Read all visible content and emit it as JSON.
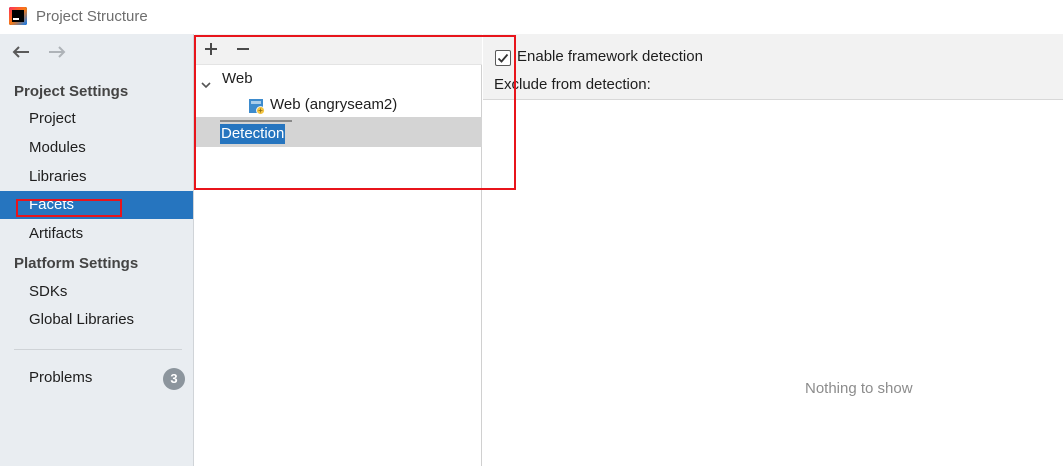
{
  "window": {
    "title": "Project Structure"
  },
  "sidebar": {
    "project_settings_heading": "Project Settings",
    "project_settings_items": [
      {
        "label": "Project"
      },
      {
        "label": "Modules"
      },
      {
        "label": "Libraries"
      },
      {
        "label": "Facets",
        "selected": true
      },
      {
        "label": "Artifacts"
      }
    ],
    "platform_settings_heading": "Platform Settings",
    "platform_settings_items": [
      {
        "label": "SDKs"
      },
      {
        "label": "Global Libraries"
      }
    ],
    "problems": {
      "label": "Problems",
      "count": "3"
    }
  },
  "middle": {
    "toolbar": {
      "add_icon": "plus-icon",
      "remove_icon": "minus-icon"
    },
    "tree": {
      "group_label": "Web",
      "child_label": "Web (angryseam2)",
      "detection_label": "Detection"
    }
  },
  "detail": {
    "enable_detection_label": "Enable framework detection",
    "enable_detection_checked": true,
    "exclude_label": "Exclude from detection:",
    "empty_text": "Nothing to show"
  },
  "colors": {
    "selection": "#2675bf",
    "sidebar_bg": "#e9edf1",
    "annotation": "#e8141b",
    "badge": "#8c959d"
  }
}
